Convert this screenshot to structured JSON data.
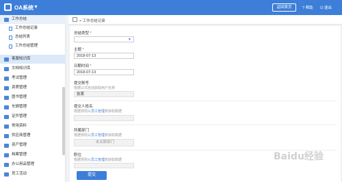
{
  "app": {
    "title": "OA系统",
    "back_button": "返回首页",
    "help": "帮助",
    "user": "退出"
  },
  "sidebar": {
    "items": [
      {
        "label": "工作总结",
        "open": true
      },
      {
        "label": "工作总结记录",
        "sub": true
      },
      {
        "label": "总结列表",
        "sub": true
      },
      {
        "label": "工作总结管理",
        "sub": true
      },
      {
        "label": "客服知识库",
        "active": true
      },
      {
        "label": "文档知识库"
      },
      {
        "label": "考试管理"
      },
      {
        "label": "资质管理"
      },
      {
        "label": "图书管理"
      },
      {
        "label": "车辆管理"
      },
      {
        "label": "证件管理"
      },
      {
        "label": "常用资料"
      },
      {
        "label": "供应商管理"
      },
      {
        "label": "资产管理"
      },
      {
        "label": "档案管理"
      },
      {
        "label": "办公用品管理"
      },
      {
        "label": "员工活动"
      }
    ]
  },
  "breadcrumb": {
    "text": "> 工作总结记录"
  },
  "form": {
    "summary_type": {
      "label": "总结类型",
      "required": "*",
      "value": ""
    },
    "subject": {
      "label": "主题",
      "required": "*",
      "value": "2018-07-13"
    },
    "date": {
      "label": "日期时间",
      "required": "*",
      "value": "2018-07-13"
    },
    "submitter_account": {
      "label": "提交账号",
      "hint": "根据公式自动获取用户名称",
      "value": "张某"
    },
    "submitter_name": {
      "label": "提交人姓名",
      "hint_prefix": "根据规则从",
      "hint_link": "员工管理",
      "hint_suffix": "表获取数据",
      "value": ""
    },
    "department": {
      "label": "所属部门",
      "hint_prefix": "根据规则从",
      "hint_link": "员工管理",
      "hint_suffix": "表获取数据",
      "value": "未关联部门"
    },
    "position": {
      "label": "职位",
      "hint_prefix": "根据规则从",
      "hint_link": "员工管理",
      "hint_suffix": "表获取数据",
      "value": ""
    },
    "submit_label": "提交"
  },
  "watermark": "Baidu经验"
}
